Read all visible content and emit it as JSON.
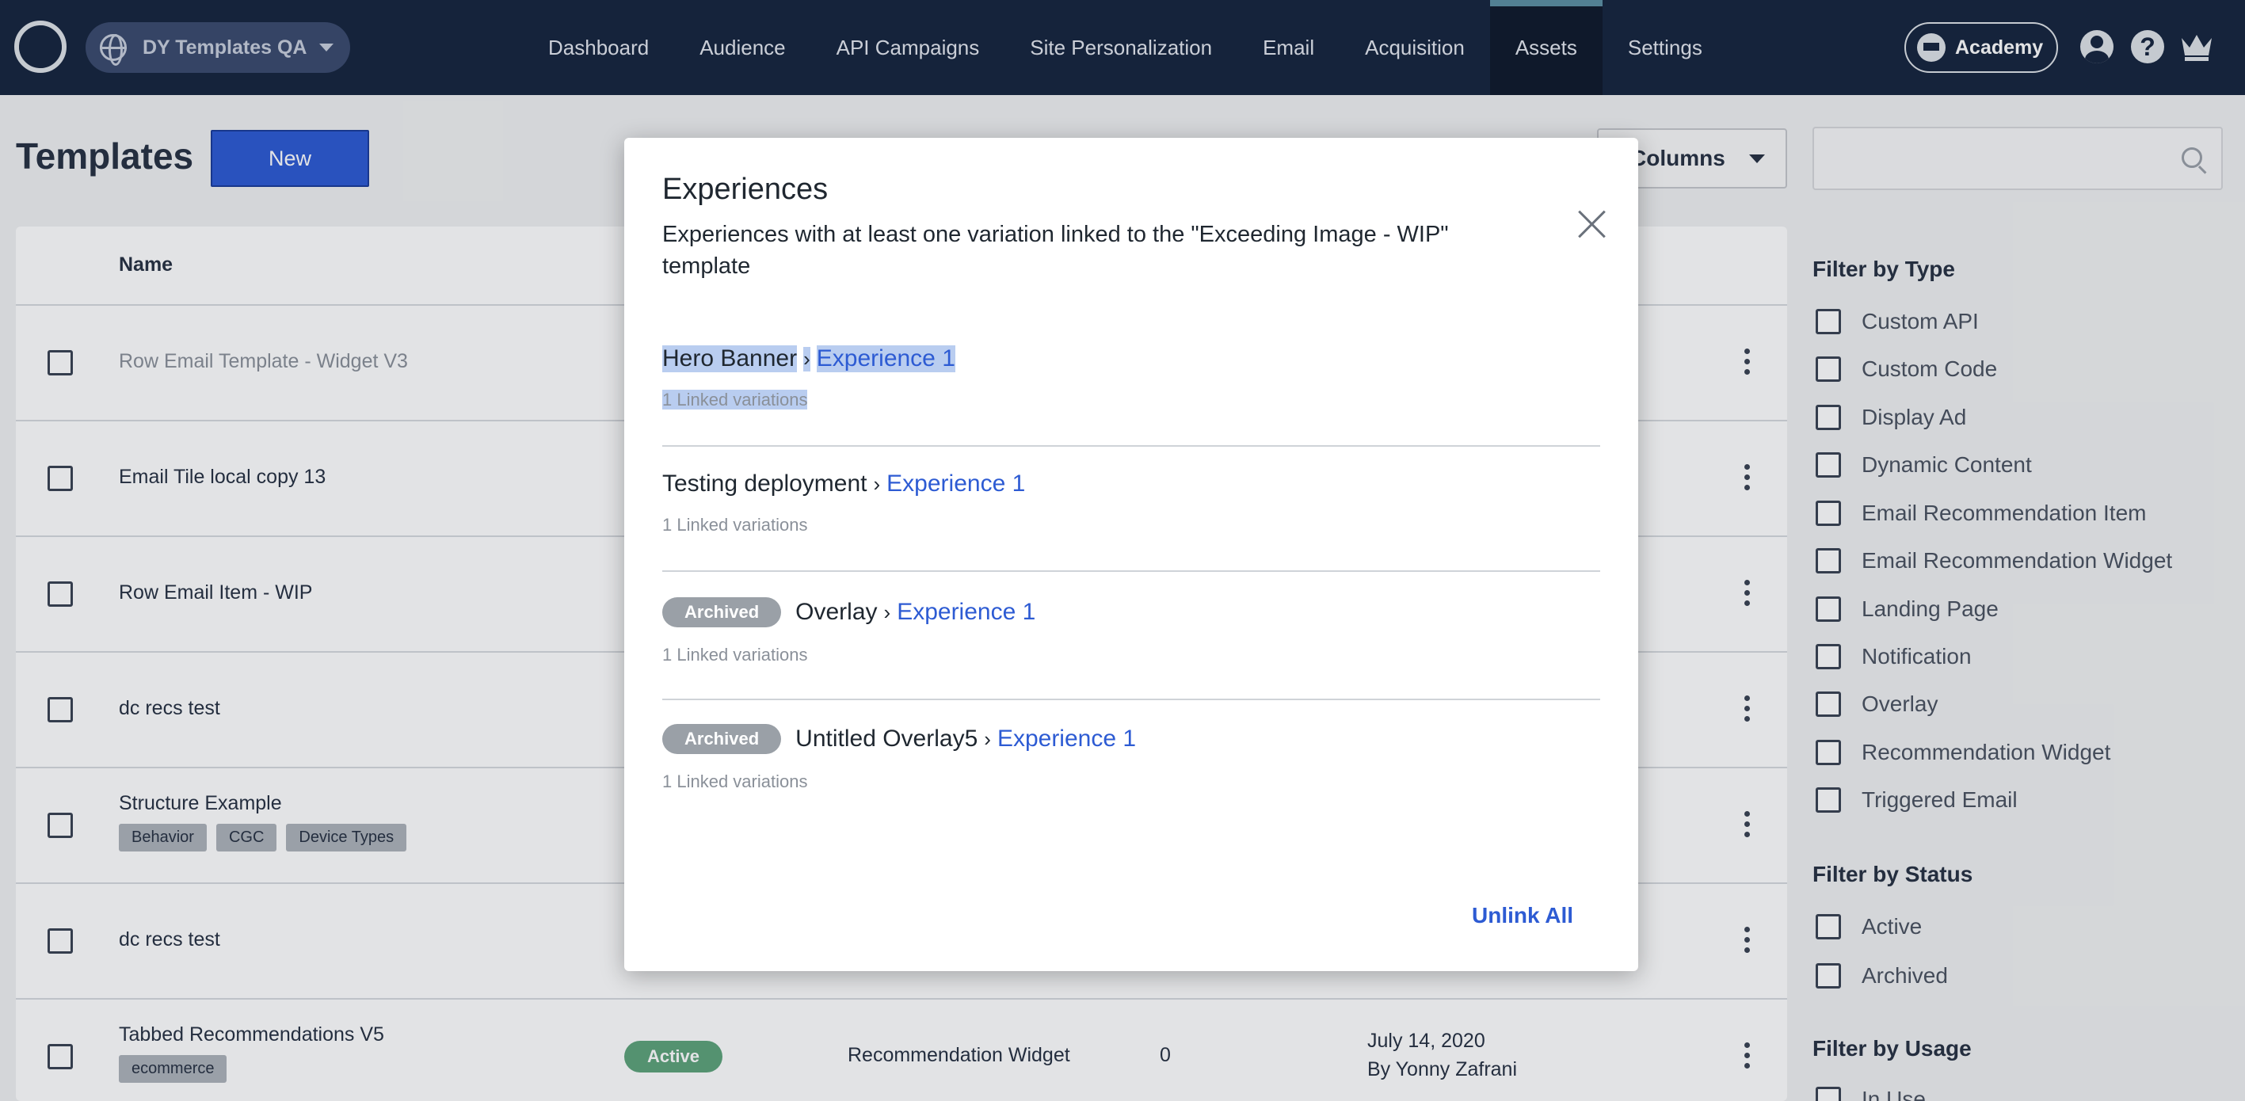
{
  "topbar": {
    "site_name": "DY Templates QA",
    "nav": [
      "Dashboard",
      "Audience",
      "API Campaigns",
      "Site Personalization",
      "Email",
      "Acquisition",
      "Assets",
      "Settings"
    ],
    "active_nav": "Assets",
    "academy_label": "Academy"
  },
  "page": {
    "title": "Templates",
    "new_label": "New",
    "columns_label": "Columns",
    "search_placeholder": ""
  },
  "table": {
    "header_name": "Name",
    "rows": [
      {
        "name": "Row Email Template - Widget V3",
        "tags": []
      },
      {
        "name": "Email Tile local copy 13",
        "tags": []
      },
      {
        "name": "Row Email Item - WIP",
        "tags": []
      },
      {
        "name": "dc recs test",
        "tags": []
      },
      {
        "name": "Structure Example",
        "tags": [
          "Behavior",
          "CGC",
          "Device Types"
        ]
      },
      {
        "name": "dc recs test",
        "tags": []
      },
      {
        "name": "Tabbed Recommendations V5",
        "tags": [
          "ecommerce"
        ],
        "status": "Active",
        "type": "Recommendation Widget",
        "count": "0",
        "date": "July 14, 2020",
        "by": "By Yonny Zafrani"
      }
    ]
  },
  "filters": {
    "type_title": "Filter by Type",
    "types": [
      "Custom API",
      "Custom Code",
      "Display Ad",
      "Dynamic Content",
      "Email Recommendation Item",
      "Email Recommendation Widget",
      "Landing Page",
      "Notification",
      "Overlay",
      "Recommendation Widget",
      "Triggered Email"
    ],
    "status_title": "Filter by Status",
    "statuses": [
      "Active",
      "Archived"
    ],
    "usage_title": "Filter by Usage",
    "usage": [
      "In Use"
    ]
  },
  "modal": {
    "title": "Experiences",
    "subtitle": "Experiences with at least one variation linked to the \"Exceeding Image - WIP\" template",
    "separator": "›",
    "experiences": [
      {
        "campaign": "Hero Banner",
        "experience": "Experience 1",
        "meta": "1 Linked variations",
        "badge": ""
      },
      {
        "campaign": "Testing deployment",
        "experience": "Experience 1",
        "meta": "1 Linked variations",
        "badge": ""
      },
      {
        "campaign": "Overlay",
        "experience": "Experience 1",
        "meta": "1 Linked variations",
        "badge": "Archived"
      },
      {
        "campaign": "Untitled Overlay5",
        "experience": "Experience 1",
        "meta": "1 Linked variations",
        "badge": "Archived"
      }
    ],
    "unlink_all_label": "Unlink All"
  }
}
